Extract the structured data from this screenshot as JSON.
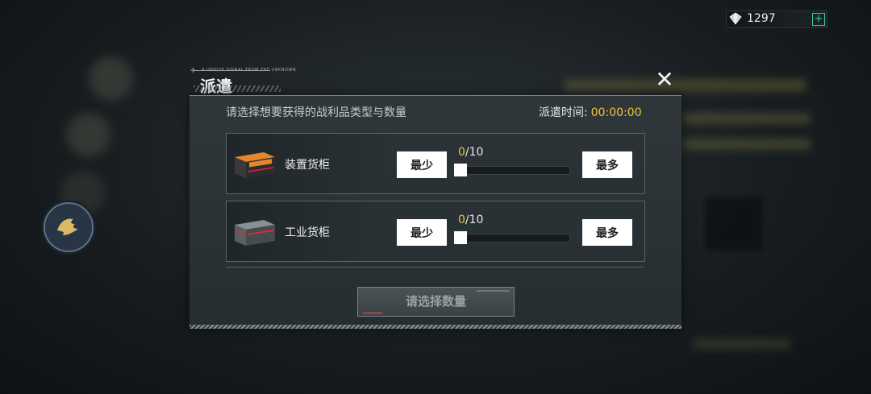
{
  "currency": {
    "icon": "diamond-icon",
    "amount": "1297",
    "add_icon": "plus-icon"
  },
  "dialog": {
    "title": "派遣",
    "subtitle_tiny": "A UNIQUE SIGNAL FROM THE UNKNOWN",
    "close_icon": "close-x-icon",
    "instruction": "请选择想要获得的战利品类型与数量",
    "dispatch_time_label": "派遣时间:",
    "dispatch_time_value": "00:00:00",
    "rows": [
      {
        "name": "装置货柜",
        "icon": "orange-crate-icon",
        "min_label": "最少",
        "max_label": "最多",
        "current": "0",
        "total": "/10",
        "fill_fraction": 0
      },
      {
        "name": "工业货柜",
        "icon": "red-crate-icon",
        "min_label": "最少",
        "max_label": "最多",
        "current": "0",
        "total": "/10",
        "fill_fraction": 0
      }
    ],
    "confirm_label": "请选择数量"
  },
  "colors": {
    "accent_yellow": "#f2c53a",
    "plus_green": "#3ec9a0"
  }
}
